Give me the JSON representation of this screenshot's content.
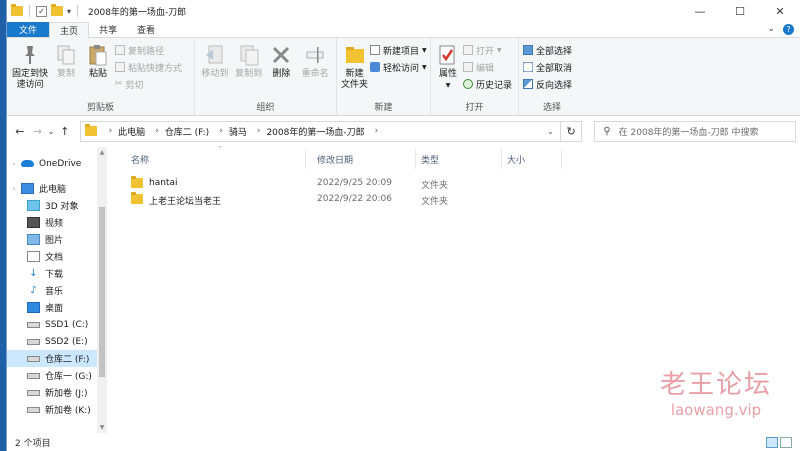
{
  "window": {
    "title": "2008年的第一场血-刀郎",
    "controls": {
      "minimize": "—",
      "maximize": "☐",
      "close": "✕"
    }
  },
  "tabs": [
    {
      "label": "文件"
    },
    {
      "label": "主页"
    },
    {
      "label": "共享"
    },
    {
      "label": "查看"
    }
  ],
  "ribbon": {
    "clipboard": {
      "label": "剪贴板",
      "pin": "固定到快\n速访问",
      "copy": "复制",
      "paste": "粘贴",
      "copy_path": "复制路径",
      "paste_shortcut": "粘贴快捷方式",
      "cut": "剪切"
    },
    "organize": {
      "label": "组织",
      "move_to": "移动到",
      "copy_to": "复制到",
      "delete": "删除",
      "rename": "重命名"
    },
    "new": {
      "label": "新建",
      "new_folder": "新建\n文件夹",
      "new_item": "新建项目",
      "easy_access": "轻松访问"
    },
    "open": {
      "label": "打开",
      "properties": "属性",
      "open": "打开",
      "edit": "编辑",
      "history": "历史记录"
    },
    "select": {
      "label": "选择",
      "select_all": "全部选择",
      "select_none": "全部取消",
      "invert": "反向选择"
    }
  },
  "address": {
    "crumbs": [
      "此电脑",
      "仓库二 (F:)",
      "骑马",
      "2008年的第一场血-刀郎"
    ],
    "search_placeholder": "在 2008年的第一场血-刀郎 中搜索"
  },
  "nav": {
    "items": [
      {
        "label": "OneDrive",
        "icon": "cloud-icon",
        "level": 0
      },
      {
        "label": "此电脑",
        "icon": "computer-icon",
        "level": 0
      },
      {
        "label": "3D 对象",
        "icon": "cube-icon",
        "level": 1
      },
      {
        "label": "视频",
        "icon": "video-icon",
        "level": 1
      },
      {
        "label": "图片",
        "icon": "picture-icon",
        "level": 1
      },
      {
        "label": "文档",
        "icon": "document-icon",
        "level": 1
      },
      {
        "label": "下载",
        "icon": "download-icon",
        "level": 1
      },
      {
        "label": "音乐",
        "icon": "music-icon",
        "level": 1
      },
      {
        "label": "桌面",
        "icon": "desktop-icon",
        "level": 1
      },
      {
        "label": "SSD1 (C:)",
        "icon": "drive-icon",
        "level": 1
      },
      {
        "label": "SSD2 (E:)",
        "icon": "drive-icon",
        "level": 1
      },
      {
        "label": "仓库二 (F:)",
        "icon": "drive-icon",
        "level": 1,
        "selected": true
      },
      {
        "label": "仓库一 (G:)",
        "icon": "drive-icon",
        "level": 1
      },
      {
        "label": "新加卷 (J:)",
        "icon": "drive-icon",
        "level": 1
      },
      {
        "label": "新加卷 (K:)",
        "icon": "drive-icon",
        "level": 1
      }
    ]
  },
  "files": {
    "columns": {
      "name": "名称",
      "modified": "修改日期",
      "type": "类型",
      "size": "大小"
    },
    "rows": [
      {
        "name": "hantai",
        "modified": "2022/9/25 20:09",
        "type": "文件夹",
        "size": ""
      },
      {
        "name": "上老王论坛当老王",
        "modified": "2022/9/22 20:06",
        "type": "文件夹",
        "size": ""
      }
    ]
  },
  "status": {
    "count": "2 个项目"
  },
  "watermark": {
    "cn": "老王论坛",
    "en": "laowang.vip"
  },
  "colors": {
    "accent": "#1979ca",
    "folder": "#f1c232",
    "selection": "#cce8ff",
    "desktop": "#1f5fa8"
  }
}
